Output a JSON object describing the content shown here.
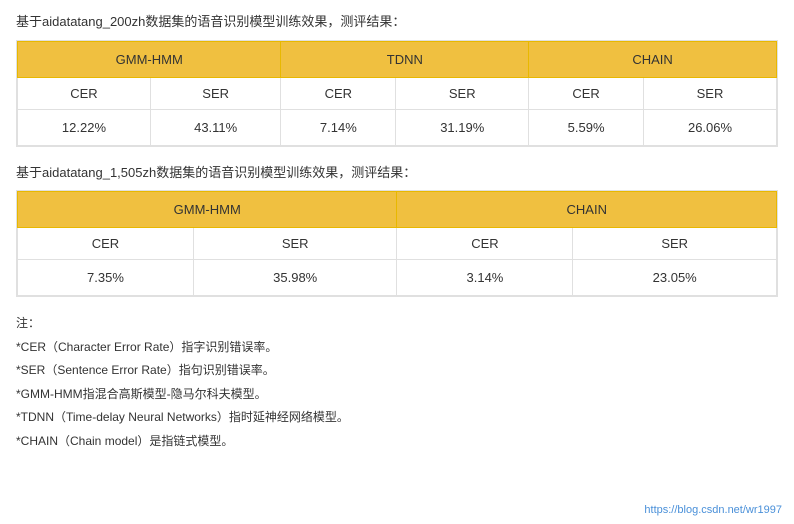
{
  "table1": {
    "title": "基于aidatatang_200zh数据集的语音识别模型训练效果，测评结果：",
    "headers": [
      {
        "label": "GMM-HMM",
        "colspan": 2
      },
      {
        "label": "TDNN",
        "colspan": 2
      },
      {
        "label": "CHAIN",
        "colspan": 2
      }
    ],
    "subheaders": [
      "CER",
      "SER",
      "CER",
      "SER",
      "CER",
      "SER"
    ],
    "data": [
      "12.22%",
      "43.11%",
      "7.14%",
      "31.19%",
      "5.59%",
      "26.06%"
    ]
  },
  "table2": {
    "title": "基于aidatatang_1,505zh数据集的语音识别模型训练效果，测评结果：",
    "headers": [
      {
        "label": "GMM-HMM",
        "colspan": 2
      },
      {
        "label": "CHAIN",
        "colspan": 2
      }
    ],
    "subheaders": [
      "CER",
      "SER",
      "CER",
      "SER"
    ],
    "data": [
      "7.35%",
      "35.98%",
      "3.14%",
      "23.05%"
    ]
  },
  "notes": {
    "label": "注：",
    "items": [
      "*CER（Character Error Rate）指字识别错误率。",
      "*SER（Sentence Error Rate）指句识别错误率。",
      "*GMM-HMM指混合高斯模型-隐马尔科夫模型。",
      "*TDNN（Time-delay Neural Networks）指时延神经网络模型。",
      "*CHAIN（Chain model）是指链式模型。"
    ]
  },
  "watermark": "https://blog.csdn.net/wr1997"
}
